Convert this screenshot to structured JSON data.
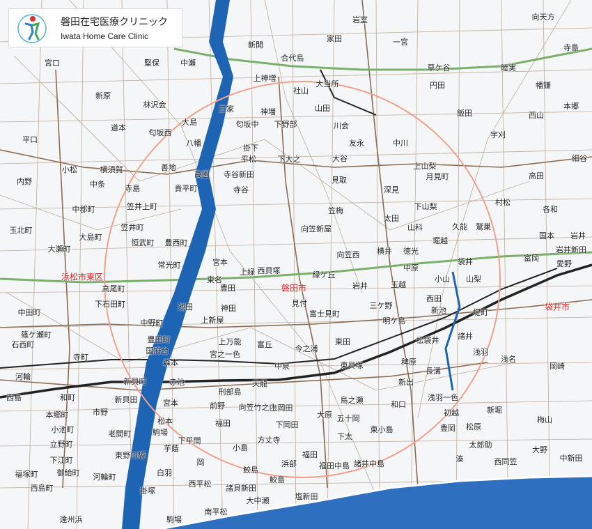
{
  "clinic": {
    "name_jp": "磐田在宅医療クリニック",
    "name_en": "Iwata Home Care Clinic"
  },
  "colors": {
    "background": "#f4f6f8",
    "road": "#b09070",
    "major_road": "#8a6a50",
    "expressway": "#7ab06a",
    "railway": "#222222",
    "river": "#1e64b4",
    "sea": "#2f6fc0",
    "service_circle": "#f2a08c",
    "city_label": "#d21e1e"
  },
  "city_labels": {
    "iwata": "磐田市",
    "hamamatsu_higashi": "浜松市東区",
    "fukuroi": "袋井市"
  },
  "place_labels": {
    "p1": "岩室",
    "p2": "向天方",
    "p3": "家田",
    "p4": "一宮",
    "p5": "寺島",
    "p6": "新開",
    "p7": "合代島",
    "p8": "草ケ谷",
    "p9": "睦実",
    "p10": "宮口",
    "p11": "堅保",
    "p12": "中瀬",
    "p13": "上神増",
    "p14": "大当所",
    "p15": "社山",
    "p16": "円田",
    "p17": "幡鎌",
    "p18": "新原",
    "p19": "林沢会",
    "p20": "三家",
    "p21": "神増",
    "p22": "山田",
    "p23": "飯田",
    "p24": "西山",
    "p25": "本郷",
    "p26": "平口",
    "p27": "道本",
    "p28": "大島",
    "p29": "匂坂西",
    "p30": "匂坂中",
    "p31": "下野部",
    "p32": "川会",
    "p33": "宇刈",
    "p34": "八幡",
    "p35": "掛下",
    "p36": "平松",
    "p37": "下大之",
    "p38": "友永",
    "p39": "中川",
    "p40": "小松",
    "p41": "横須賀",
    "p42": "善地",
    "p43": "高園",
    "p44": "寺谷新田",
    "p45": "大谷",
    "p46": "上山梨",
    "p47": "高田",
    "p48": "細谷",
    "p49": "内野",
    "p50": "中条",
    "p51": "寺島",
    "p52": "貴平町",
    "p53": "寺谷",
    "p54": "見取",
    "p55": "深見",
    "p56": "月見町",
    "p57": "村松",
    "p58": "中郡町",
    "p59": "笠井上町",
    "p60": "笠梅",
    "p61": "下山梨",
    "p62": "各和",
    "p63": "向笠新屋",
    "p64": "太田",
    "p65": "山科",
    "p66": "久能",
    "p67": "鷲巣",
    "p68": "国本",
    "p69": "玉北町",
    "p70": "笠井町",
    "p71": "大島町",
    "p72": "岩井",
    "p73": "岩井新田",
    "p74": "堀越",
    "p75": "恒武町",
    "p76": "豊西町",
    "p77": "向笠西",
    "p78": "横井",
    "p79": "徳光",
    "p80": "大瀬町",
    "p81": "宮本",
    "p82": "常光町",
    "p83": "上緑",
    "p84": "西貝塚",
    "p85": "中原",
    "p86": "袋井",
    "p87": "愛野",
    "p88": "富岡",
    "p89": "東名",
    "p90": "緑ケ丘",
    "p91": "豊田",
    "p92": "岩井",
    "p93": "玉越",
    "p94": "小山",
    "p95": "山梨",
    "p96": "高尾町",
    "p97": "下石田町",
    "p98": "池田",
    "p99": "神田",
    "p100": "見付",
    "p101": "三ケ野",
    "p102": "西田",
    "p103": "新池",
    "p104": "中田町",
    "p105": "上新屋",
    "p106": "富士見町",
    "p107": "明ケ島",
    "p108": "諸井",
    "p109": "堤町",
    "p110": "篠ケ瀬町",
    "p111": "中野町",
    "p112": "宮之一色",
    "p113": "東田",
    "p114": "松袋井",
    "p115": "浅羽",
    "p116": "石西町",
    "p117": "豊田町",
    "p118": "上万能",
    "p119": "富丘",
    "p120": "今之浦",
    "p121": "国府台",
    "p122": "寺町",
    "p123": "森本",
    "p124": "中泉",
    "p125": "東貝塚",
    "p126": "稗原",
    "p127": "長溝",
    "p128": "浅名",
    "p129": "岡崎",
    "p130": "新貝町",
    "p131": "赤池",
    "p132": "刑部島",
    "p133": "天龍",
    "p134": "新出",
    "p135": "河輪",
    "p136": "和町",
    "p137": "新貝田",
    "p138": "宮本",
    "p139": "前野",
    "p140": "鳥之瀬",
    "p141": "和口",
    "p142": "浅羽一色",
    "p143": "西島",
    "p144": "本郷町",
    "p145": "市野",
    "p146": "向笠竹之内",
    "p147": "上岡田",
    "p148": "大原",
    "p149": "五十岡",
    "p150": "初越",
    "p151": "新堀",
    "p152": "梅山",
    "p153": "小池町",
    "p154": "老間町",
    "p155": "松本",
    "p156": "下岡田",
    "p157": "東小島",
    "p158": "松原",
    "p159": "福田",
    "p160": "豊岡",
    "p161": "駒場",
    "p162": "太郎助",
    "p163": "大野",
    "p164": "立野町",
    "p165": "東野川袋",
    "p166": "下平間",
    "p167": "小島",
    "p168": "方丈寺",
    "p169": "下太",
    "p170": "湊",
    "p171": "西同笠",
    "p172": "中新田",
    "p173": "下江町",
    "p174": "芋蔭",
    "p175": "岡",
    "p176": "浜部",
    "p177": "鮫島",
    "p178": "福田中島",
    "p179": "福田",
    "p180": "福塚町",
    "p181": "御給町",
    "p182": "河輪町",
    "p183": "白羽",
    "p184": "西平松",
    "p185": "諸井中島",
    "p186": "鮫島",
    "p187": "西島町",
    "p188": "掛塚",
    "p189": "諸貝新田",
    "p190": "塩新田",
    "p191": "大中瀬",
    "p192": "南平松",
    "p193": "遠州浜",
    "p194": "駒場"
  }
}
